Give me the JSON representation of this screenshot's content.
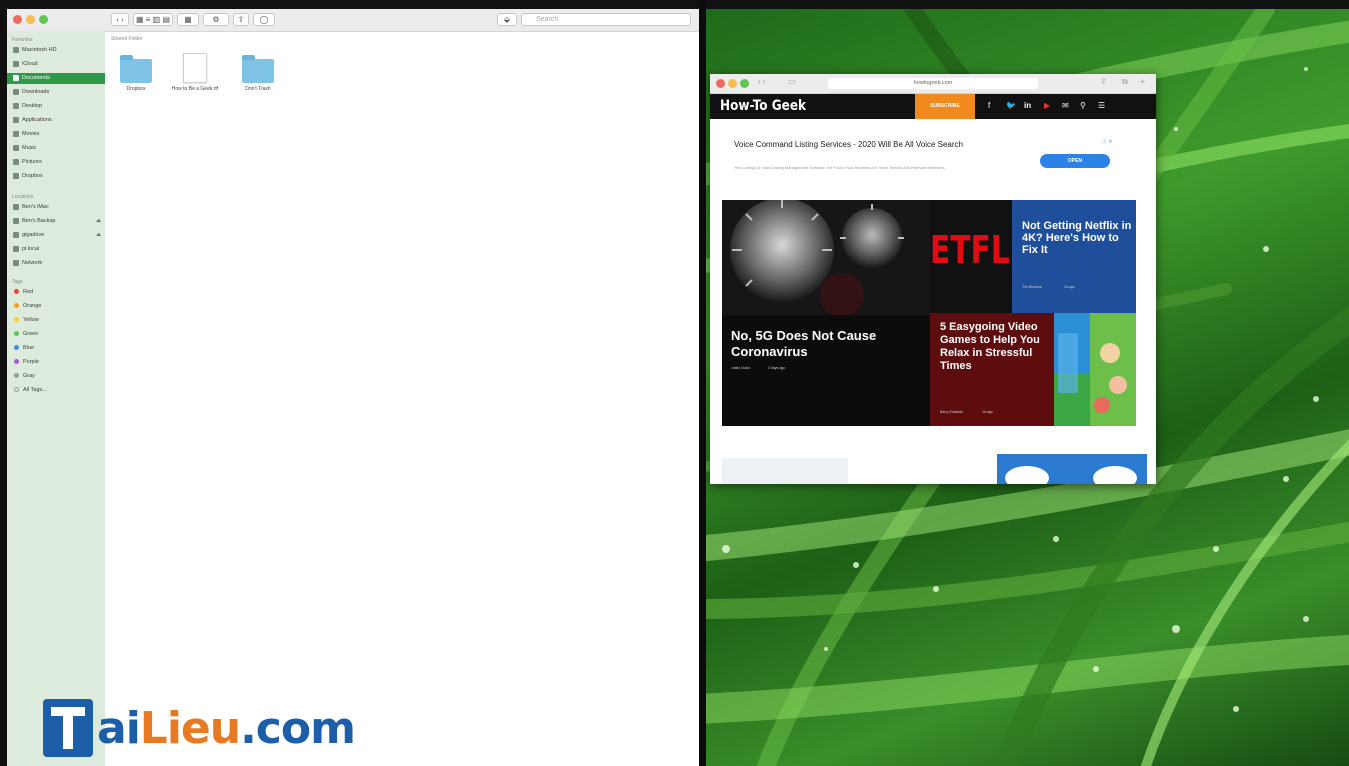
{
  "finder": {
    "search_placeholder": "Search",
    "path_label": "Shared Folder",
    "sidebar": {
      "favorites_heading": "Favorites",
      "favorites": [
        {
          "label": "Macintosh HD",
          "icon": "disk-icon"
        },
        {
          "label": "iCloud",
          "icon": "cloud-icon"
        },
        {
          "label": "Documents",
          "icon": "document-icon",
          "selected": true
        },
        {
          "label": "Downloads",
          "icon": "download-icon"
        },
        {
          "label": "Desktop",
          "icon": "desktop-icon"
        },
        {
          "label": "Applications",
          "icon": "applications-icon"
        },
        {
          "label": "Movies",
          "icon": "film-icon"
        },
        {
          "label": "Music",
          "icon": "music-icon"
        },
        {
          "label": "Pictures",
          "icon": "camera-icon"
        },
        {
          "label": "Dropbox",
          "icon": "dropbox-icon"
        }
      ],
      "locations_heading": "Locations",
      "locations": [
        {
          "label": "Ben's iMac",
          "icon": "imac-icon"
        },
        {
          "label": "Ben's Backup",
          "icon": "drive-icon",
          "eject": true
        },
        {
          "label": "gigadrive",
          "icon": "drive-icon",
          "eject": true
        },
        {
          "label": "pi.local",
          "icon": "server-icon"
        },
        {
          "label": "Network",
          "icon": "network-icon"
        }
      ],
      "tags_heading": "Tags",
      "tags": [
        {
          "label": "Red",
          "color": "#e8453c"
        },
        {
          "label": "Orange",
          "color": "#f39c2b"
        },
        {
          "label": "Yellow",
          "color": "#f5cf2f"
        },
        {
          "label": "Green",
          "color": "#5cc45c"
        },
        {
          "label": "Blue",
          "color": "#3a8de0"
        },
        {
          "label": "Purple",
          "color": "#a25dd1"
        },
        {
          "label": "Gray",
          "color": "#9a9a9a"
        }
      ],
      "all_tags": "All Tags..."
    },
    "files": [
      {
        "label": "Dropbox",
        "kind": "folder"
      },
      {
        "label": "How to Be a Geek.rtf",
        "kind": "document"
      },
      {
        "label": "Don't Trash",
        "kind": "folder"
      }
    ]
  },
  "watermark": {
    "part1": "T",
    "part2": "ai",
    "part3": "Lieu",
    "part4": ".com"
  },
  "safari": {
    "url": "howtogeek.com",
    "site_logo": "How-To Geek",
    "subscribe_label": "SUBSCRIBE",
    "nav_icons": [
      "facebook-icon",
      "twitter-icon",
      "linkedin-icon",
      "youtube-icon",
      "mail-icon",
      "search-icon",
      "menu-icon"
    ],
    "ad": {
      "title": "Voice Command Listing Services - 2020 Will Be All Voice Search",
      "description": "Yext Listings & Voice Listing Management Software. Be Found Your Business On Voice Search And Relevant Websites.",
      "button": "OPEN",
      "choice_label": "ⓘ ✕"
    },
    "articles": [
      {
        "title": "No, 5G Does Not Cause Coronavirus",
        "author": "Justin Duino",
        "age": "2 days ago"
      },
      {
        "title": "Not Getting Netflix in 4K? Here's How to Fix It",
        "author": "Tim Brookes",
        "age": "1d ago",
        "image_text": "ETFL"
      },
      {
        "title": "5 Easygoing Video Games to Help You Relax in Stressful Times",
        "author": "Barry Edwards",
        "age": "1d ago"
      }
    ]
  },
  "colors": {
    "finder_sidebar": "#dcebdc",
    "selected_row": "#2f9a4a",
    "htg_orange": "#f08a1c",
    "netflix_blue": "#1f4f9a",
    "games_red": "#5e0d0e"
  }
}
